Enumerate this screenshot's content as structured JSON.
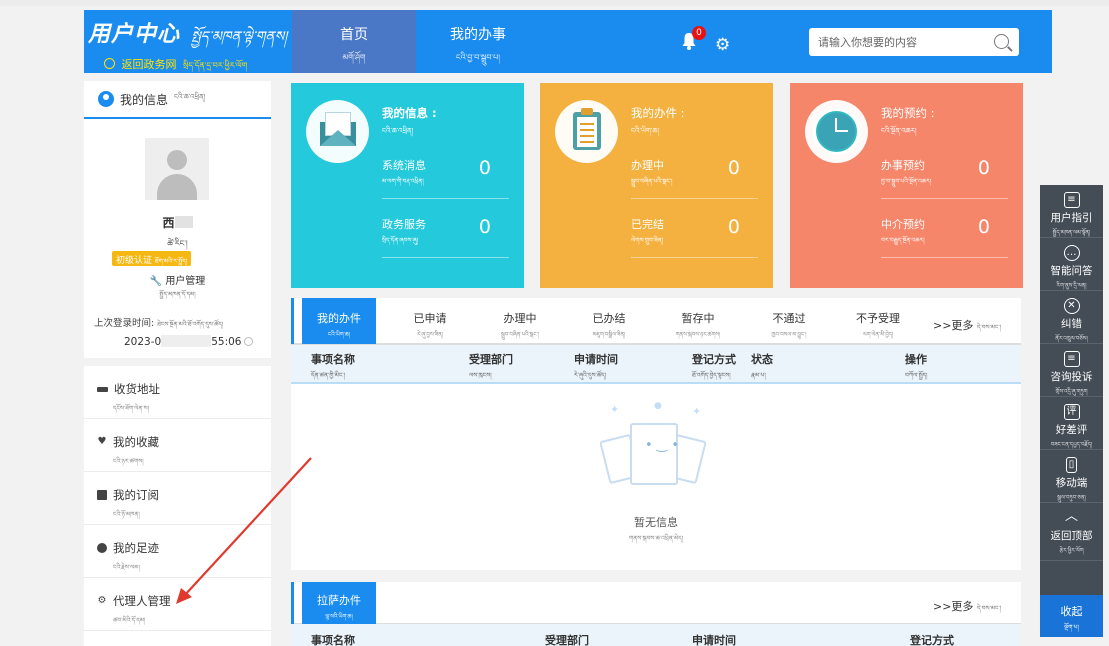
{
  "header": {
    "brand_title": "用户中心",
    "brand_title_tib": "སྤྱོད་མཁན་ལྟེ་གནས།",
    "back_link": "返回政务网",
    "back_link_tib": "སྲིད་དོན་དྲ་བར་ཕྱིར་ལོག",
    "nav": [
      {
        "label": "首页",
        "tib": "མགོ་ཤོག"
      },
      {
        "label": "我的办事",
        "tib": "ངའི་བྱ་བ་སྒྲུབ་པ།"
      }
    ],
    "notification_count": "0",
    "search_placeholder": "请输入你想要的内容"
  },
  "sidebar": {
    "title": "我的信息",
    "title_tib": "ངའི་ཆ་འཕྲིན།",
    "user_name": "西",
    "user_name_tib": "ཚེ་རིང་།",
    "verify_label": "初级认证",
    "verify_tib": "ཐོག་མའི་ར་སྤྲོད།",
    "user_manage": "用户管理",
    "user_manage_tib": "སྤྱོད་མཁན་དོ་དམ།",
    "last_login_label": "上次登录时间:",
    "last_login_tib": "ཐེངས་སྔོན་མའི་ཐོ་འགོད་དུས་ཚོད།",
    "last_login_date_start": "2023-0",
    "last_login_date_end": "55:06",
    "menu": [
      {
        "label": "收货地址",
        "tib": "དངོས་ཟོག་ལེན་ས།"
      },
      {
        "label": "我的收藏",
        "tib": "ངའི་ཉར་ཚགས།"
      },
      {
        "label": "我的订阅",
        "tib": "ངའི་ཉོ་མཁན།"
      },
      {
        "label": "我的足迹",
        "tib": "ངའི་རྗེས་ལམ།"
      },
      {
        "label": "代理人管理",
        "tib": "ཚབ་མིའི་དོ་དམ།"
      }
    ]
  },
  "cards": [
    {
      "title": "我的信息 :",
      "title_tib": "ངའི་ཆ་འཕྲིན།",
      "rows": [
        {
          "label": "系统消息",
          "tib": "མ་ལག་གི་བརྡ་འཕྲིན།",
          "value": "0"
        },
        {
          "label": "政务服务",
          "tib": "སྲིད་དོན་ཞབས་ཞུ།",
          "value": "0"
        }
      ]
    },
    {
      "title": "我的办件 :",
      "title_tib": "ངའི་ཡིག་ཆ།",
      "rows": [
        {
          "label": "办理中",
          "tib": "སྒྲུབ་བཞིན་པའི་སྒང་།",
          "value": "0"
        },
        {
          "label": "已完结",
          "tib": "ལེགས་གྲུབ་ཟིན།",
          "value": "0"
        }
      ]
    },
    {
      "title": "我的预约 :",
      "title_tib": "ངའི་སྔོན་འཆར།",
      "rows": [
        {
          "label": "办事预约",
          "tib": "བྱ་བ་སྒྲུབ་པའི་སྔོན་འཆར།",
          "value": "0"
        },
        {
          "label": "中介预约",
          "tib": "བར་བརྒྱུད་སྔོན་འཆར།",
          "value": "0"
        }
      ]
    }
  ],
  "main_tabs": {
    "tabs": [
      {
        "label": "我的办件",
        "tib": "ངའི་ཡིག་ཆ།"
      },
      {
        "label": "已申请",
        "tib": "རེ་ཞུ་བྱས་ཟིན།"
      },
      {
        "label": "办理中",
        "tib": "སྒྲུབ་བཞིན་པའི་སྒང་།"
      },
      {
        "label": "已办结",
        "tib": "མཇུག་བསྒྲིལ་ཟིན།"
      },
      {
        "label": "暂存中",
        "tib": "གནས་སྐབས་ཉར་ཚགས།"
      },
      {
        "label": "不通过",
        "tib": "ཁྱབ་བསལ་མ་བྱུང་།"
      },
      {
        "label": "不予受理",
        "tib": "ལག་ལེན་མི་བྱེད།"
      }
    ],
    "more": ">>更多",
    "more_tib": "དེ་བས་མང་།",
    "columns": [
      {
        "label": "事项名称",
        "tib": "དོན་ཚན་གྱི་མིང་།"
      },
      {
        "label": "受理部门",
        "tib": "ལས་ཁུངས།"
      },
      {
        "label": "申请时间",
        "tib": "རེ་ཞུའི་དུས་ཚོད།"
      },
      {
        "label": "登记方式",
        "tib": "ཐོ་འགོད་བྱེད་སྟངས།"
      },
      {
        "label": "状态",
        "tib": "རྣམ་པ།"
      },
      {
        "label": "操作",
        "tib": "བཀོལ་སྤྱོད།"
      }
    ],
    "empty_text": "暂无信息",
    "empty_tib": "གནས་སྐབས་ཆ་འཕྲིན་མེད།"
  },
  "second_panel": {
    "tab_label": "拉萨办件",
    "tab_tib": "ལྷ་སའི་ཡིག་ཆ།",
    "more": ">>更多",
    "more_tib": "དེ་བས་མང་།",
    "columns": [
      "事项名称",
      "受理部门",
      "申请时间",
      "登记方式"
    ]
  },
  "right_toolbar": {
    "items": [
      {
        "label": "用户指引",
        "tib": "སྤྱོད་མཁན་ལམ་སྟོན།",
        "icon": "guide-icon"
      },
      {
        "label": "智能问答",
        "tib": "རིག་ནུས་དྲི་ལན།",
        "icon": "chat-icon"
      },
      {
        "label": "纠错",
        "tib": "ནོར་འཁྲུལ་བཅོས།",
        "icon": "error-icon"
      },
      {
        "label": "咨询投诉",
        "tib": "གྲོས་འདྲི་ཞུ་གཏུག",
        "icon": "complaint-icon"
      },
      {
        "label": "好差评",
        "tib": "བཟང་ངན་དཔྱད་བརྗོད།",
        "icon": "rating-icon"
      },
      {
        "label": "移动端",
        "tib": "སྒུལ་བཏུབ་ཅན།",
        "icon": "mobile-icon"
      },
      {
        "label": "返回顶部",
        "tib": "རྩེར་ཕྱིར་ལོག",
        "icon": "top-icon"
      }
    ],
    "collapse_label": "收起",
    "collapse_tib": "ལྡོག་པ།"
  },
  "colors": {
    "header_blue": "#1a8cf0",
    "teal": "#24cadb",
    "orange": "#f5b13f",
    "salmon": "#f5866a",
    "arrow_red": "#e03a2f"
  }
}
